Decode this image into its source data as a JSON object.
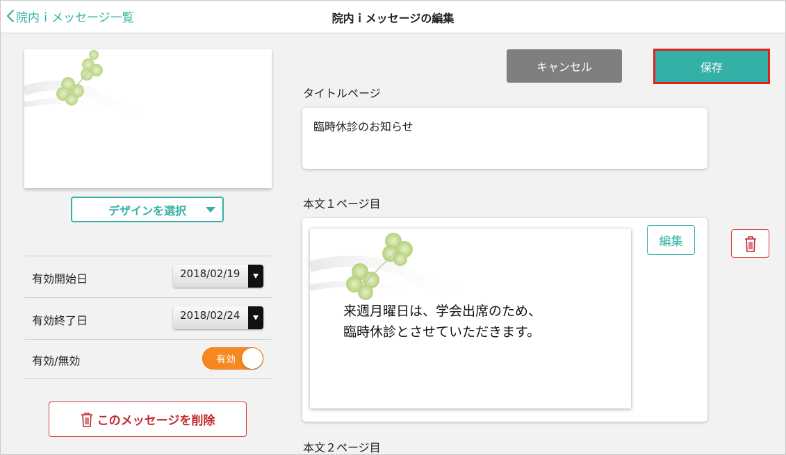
{
  "header": {
    "back_label": "院内ｉメッセージ一覧",
    "title": "院内ｉメッセージの編集"
  },
  "left": {
    "design_select_label": "デザインを選択",
    "settings": {
      "start_label": "有効開始日",
      "start_value": "2018/02/19",
      "end_label": "有効終了日",
      "end_value": "2018/02/24",
      "enabled_label": "有効/無効",
      "enabled_toggle_text": "有効",
      "enabled_on": true
    },
    "delete_label": "このメッセージを削除"
  },
  "toolbar": {
    "cancel_label": "キャンセル",
    "save_label": "保存"
  },
  "title_page": {
    "section_label": "タイトルページ",
    "value": "臨時休診のお知らせ"
  },
  "page1": {
    "section_label": "本文１ページ目",
    "lines": [
      "来週月曜日は、学会出席のため、",
      "臨時休診とさせていただきます。"
    ],
    "edit_label": "編集"
  },
  "page2": {
    "section_label": "本文２ページ目"
  },
  "colors": {
    "accent": "#35b0a6",
    "danger": "#c0282d",
    "toggle_on": "#f7871f",
    "cancel": "#7f7f7f",
    "highlight": "#e0201d"
  },
  "icons": {
    "back": "chevron-left-icon",
    "design_caret": "caret-down-icon",
    "date_caret": "caret-down-icon",
    "delete": "trash-icon",
    "page_delete": "trash-icon",
    "decoration": "clover-icon"
  }
}
